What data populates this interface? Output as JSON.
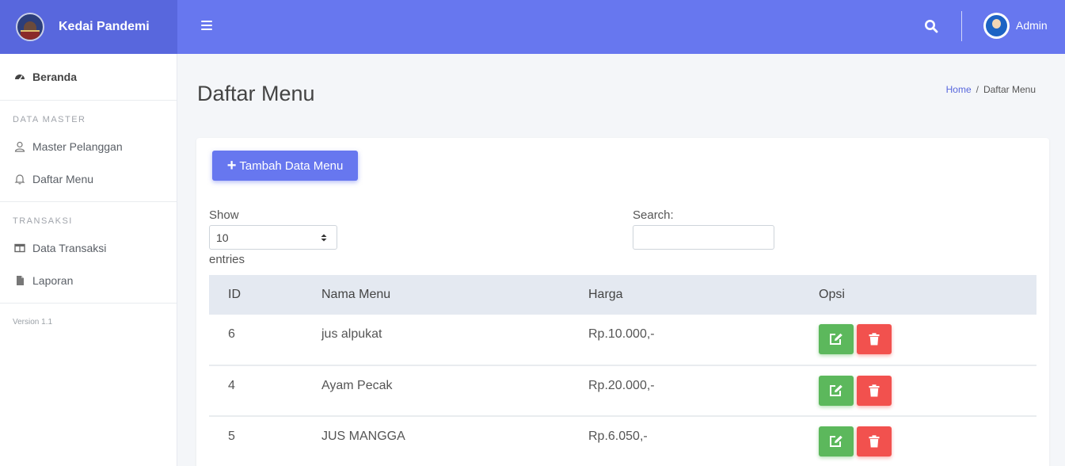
{
  "app": {
    "brand_title": "Kedai Pandemi"
  },
  "topbar": {
    "user_name": "Admin"
  },
  "sidebar": {
    "home": "Beranda",
    "section_master": "DATA MASTER",
    "master_items": [
      {
        "label": "Master Pelanggan",
        "icon": "user-icon"
      },
      {
        "label": "Daftar Menu",
        "icon": "bell-icon"
      }
    ],
    "section_transaksi": "TRANSAKSI",
    "transaksi_items": [
      {
        "label": "Data Transaksi",
        "icon": "table-icon"
      },
      {
        "label": "Laporan",
        "icon": "file-icon"
      }
    ],
    "version": "Version 1.1"
  },
  "page": {
    "title": "Daftar Menu",
    "breadcrumb": {
      "home": "Home",
      "separator": "/",
      "current": "Daftar Menu"
    }
  },
  "card": {
    "add_button": "Tambah Data Menu",
    "show_label": "Show",
    "page_size": "10",
    "entries_label": "entries",
    "search_label": "Search:"
  },
  "table": {
    "columns": [
      "ID",
      "Nama Menu",
      "Harga",
      "Opsi"
    ],
    "rows": [
      {
        "id": "6",
        "nama": "jus alpukat",
        "harga": "Rp.10.000,-"
      },
      {
        "id": "4",
        "nama": "Ayam Pecak",
        "harga": "Rp.20.000,-"
      },
      {
        "id": "5",
        "nama": "JUS MANGGA",
        "harga": "Rp.6.050,-"
      }
    ]
  },
  "colors": {
    "brand": "#5867dd",
    "topbar": "#6777ef",
    "primary_button": "#6777ef",
    "edit_button": "#5cb85c",
    "delete_button": "#f2514e"
  }
}
